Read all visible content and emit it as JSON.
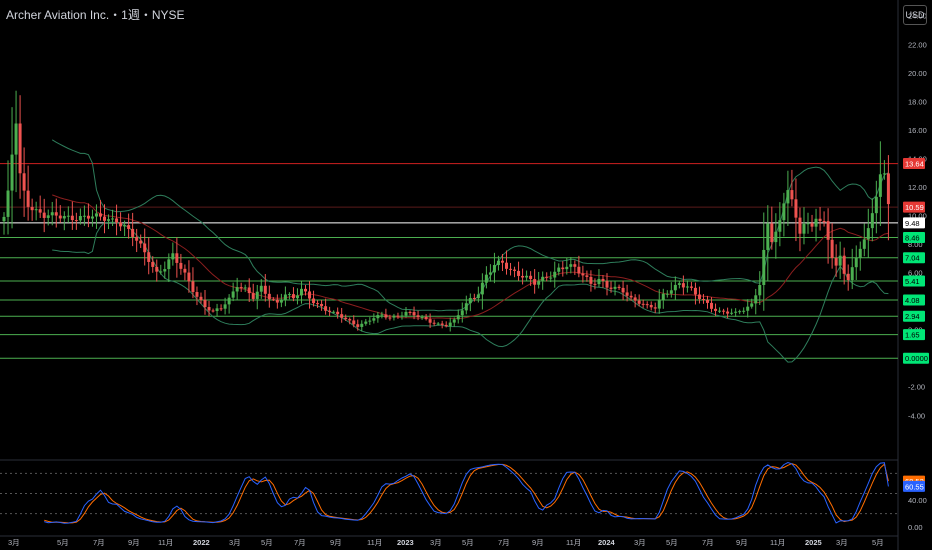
{
  "header": {
    "title": "Archer Aviation Inc.・1週・NYSE",
    "currency_button": "USD"
  },
  "colors": {
    "background": "#000000",
    "up": "#26a69a",
    "up_bright": "#4caf50",
    "down": "#ef5350",
    "resistance_line": "#b71c1c",
    "support_line": "#4caf50",
    "bollinger": "#2e7d5b",
    "ma": "#8b1e1e",
    "stoch_k": "#2962ff",
    "stoch_d": "#ff6d00"
  },
  "price_axis": {
    "labels": [
      "24.00",
      "22.00",
      "20.00",
      "18.00",
      "16.00",
      "14.00",
      "12.00",
      "10.00",
      "8.00",
      "6.00",
      "4.00",
      "2.00",
      "0.00",
      "-2.00",
      "-4.00"
    ],
    "values": [
      24,
      22,
      20,
      18,
      16,
      14,
      12,
      10,
      8,
      6,
      4,
      2,
      0,
      -2,
      -4
    ]
  },
  "price_badges": [
    {
      "text": "13.64",
      "value": 13.64,
      "bg": "#e53935",
      "fg": "#ffffff"
    },
    {
      "text": "10.59",
      "value": 10.59,
      "bg": "#e53935",
      "fg": "#ffffff"
    },
    {
      "text": "9.48",
      "value": 9.48,
      "bg": "#ffffff",
      "fg": "#000000"
    },
    {
      "text": "8.46",
      "value": 8.46,
      "bg": "#00e676",
      "fg": "#000000"
    },
    {
      "text": "7.04",
      "value": 7.04,
      "bg": "#00e676",
      "fg": "#000000"
    },
    {
      "text": "5.41",
      "value": 5.41,
      "bg": "#00e676",
      "fg": "#000000"
    },
    {
      "text": "4.08",
      "value": 4.08,
      "bg": "#00e676",
      "fg": "#000000"
    },
    {
      "text": "2.94",
      "value": 2.94,
      "bg": "#00e676",
      "fg": "#000000"
    },
    {
      "text": "1.65",
      "value": 1.65,
      "bg": "#00e676",
      "fg": "#000000"
    },
    {
      "text": "0.0000",
      "value": 0.0,
      "bg": "#00e676",
      "fg": "#000000"
    }
  ],
  "horizontal_lines": {
    "resistance": [
      13.64
    ],
    "ma_level": [
      10.59
    ],
    "current": [
      9.48
    ],
    "support": [
      8.46,
      7.04,
      5.41,
      4.08,
      2.94,
      1.65,
      0.0
    ]
  },
  "oscillator": {
    "axis_labels": [
      "40.00",
      "0.00"
    ],
    "axis_values": [
      40,
      0
    ],
    "dotted_levels": [
      80,
      50,
      20
    ],
    "badges": [
      {
        "text": "68.52",
        "value": 68.52,
        "bg": "#ff6d00"
      },
      {
        "text": "60.55",
        "value": 60.55,
        "bg": "#2962ff"
      }
    ]
  },
  "time_axis": {
    "labels": [
      "3月",
      "5月",
      "7月",
      "9月",
      "11月",
      "2022",
      "3月",
      "5月",
      "7月",
      "9月",
      "11月",
      "2023",
      "3月",
      "5月",
      "7月",
      "9月",
      "11月",
      "2024",
      "3月",
      "5月",
      "7月",
      "9月",
      "11月",
      "2025",
      "3月",
      "5月"
    ],
    "bold": [
      "2022",
      "2023",
      "2024",
      "2025"
    ]
  },
  "chart_data": {
    "type": "candlestick",
    "timeframe": "weekly",
    "start": "2021-02",
    "weeks": 221,
    "close_keypoints": [
      [
        0,
        9.9
      ],
      [
        1,
        11.5
      ],
      [
        2,
        14.2
      ],
      [
        3,
        16.5
      ],
      [
        4,
        12.8
      ],
      [
        5,
        11.6
      ],
      [
        6,
        10.8
      ],
      [
        8,
        10.4
      ],
      [
        10,
        10.0
      ],
      [
        13,
        9.9
      ],
      [
        18,
        9.9
      ],
      [
        24,
        9.85
      ],
      [
        28,
        9.7
      ],
      [
        30,
        9.2
      ],
      [
        33,
        8.2
      ],
      [
        36,
        7.0
      ],
      [
        38,
        6.0
      ],
      [
        40,
        6.4
      ],
      [
        42,
        7.1
      ],
      [
        44,
        6.3
      ],
      [
        46,
        5.4
      ],
      [
        48,
        4.4
      ],
      [
        50,
        3.6
      ],
      [
        52,
        3.2
      ],
      [
        54,
        3.5
      ],
      [
        56,
        4.2
      ],
      [
        58,
        5.2
      ],
      [
        60,
        4.8
      ],
      [
        62,
        4.2
      ],
      [
        64,
        4.9
      ],
      [
        66,
        4.3
      ],
      [
        68,
        3.9
      ],
      [
        70,
        4.5
      ],
      [
        72,
        4.1
      ],
      [
        74,
        4.8
      ],
      [
        76,
        4.3
      ],
      [
        78,
        3.8
      ],
      [
        80,
        3.4
      ],
      [
        82,
        3.1
      ],
      [
        84,
        2.9
      ],
      [
        86,
        2.6
      ],
      [
        88,
        2.3
      ],
      [
        90,
        2.5
      ],
      [
        92,
        2.8
      ],
      [
        94,
        3.0
      ],
      [
        96,
        2.9
      ],
      [
        98,
        3.0
      ],
      [
        100,
        3.2
      ],
      [
        102,
        3.0
      ],
      [
        104,
        2.8
      ],
      [
        106,
        2.6
      ],
      [
        108,
        2.4
      ],
      [
        110,
        2.3
      ],
      [
        112,
        2.6
      ],
      [
        114,
        3.4
      ],
      [
        116,
        4.2
      ],
      [
        118,
        4.6
      ],
      [
        120,
        5.8
      ],
      [
        122,
        6.4
      ],
      [
        124,
        6.7
      ],
      [
        126,
        6.2
      ],
      [
        128,
        6.0
      ],
      [
        130,
        5.6
      ],
      [
        132,
        5.2
      ],
      [
        134,
        5.5
      ],
      [
        136,
        5.9
      ],
      [
        138,
        6.3
      ],
      [
        140,
        6.5
      ],
      [
        142,
        6.2
      ],
      [
        144,
        5.8
      ],
      [
        146,
        5.3
      ],
      [
        148,
        5.6
      ],
      [
        150,
        5.0
      ],
      [
        152,
        4.8
      ],
      [
        154,
        4.7
      ],
      [
        156,
        4.2
      ],
      [
        158,
        4.0
      ],
      [
        160,
        3.6
      ],
      [
        162,
        3.5
      ],
      [
        164,
        4.4
      ],
      [
        166,
        4.9
      ],
      [
        168,
        5.3
      ],
      [
        170,
        5.0
      ],
      [
        172,
        4.4
      ],
      [
        174,
        4.0
      ],
      [
        176,
        3.6
      ],
      [
        178,
        3.3
      ],
      [
        180,
        3.2
      ],
      [
        182,
        3.1
      ],
      [
        184,
        3.4
      ],
      [
        186,
        3.8
      ],
      [
        188,
        5.3
      ],
      [
        189,
        7.5
      ],
      [
        190,
        9.3
      ],
      [
        191,
        8.2
      ],
      [
        193,
        9.4
      ],
      [
        194,
        10.8
      ],
      [
        195,
        12.0
      ],
      [
        196,
        11.2
      ],
      [
        197,
        9.8
      ],
      [
        198,
        8.9
      ],
      [
        199,
        9.6
      ],
      [
        201,
        9.0
      ],
      [
        202,
        9.8
      ],
      [
        204,
        9.4
      ],
      [
        205,
        8.3
      ],
      [
        206,
        7.3
      ],
      [
        207,
        6.6
      ],
      [
        208,
        7.1
      ],
      [
        209,
        6.0
      ],
      [
        210,
        5.6
      ],
      [
        211,
        6.2
      ],
      [
        212,
        6.8
      ],
      [
        213,
        7.7
      ],
      [
        214,
        8.4
      ],
      [
        215,
        9.0
      ],
      [
        216,
        10.2
      ],
      [
        217,
        11.6
      ],
      [
        218,
        13.0
      ],
      [
        219,
        12.8
      ],
      [
        220,
        10.8
      ]
    ],
    "price_range": [
      -4,
      24
    ],
    "oscillator_type": "stochastic",
    "oscillator_last": {
      "k": 60.55,
      "d": 68.52
    }
  }
}
